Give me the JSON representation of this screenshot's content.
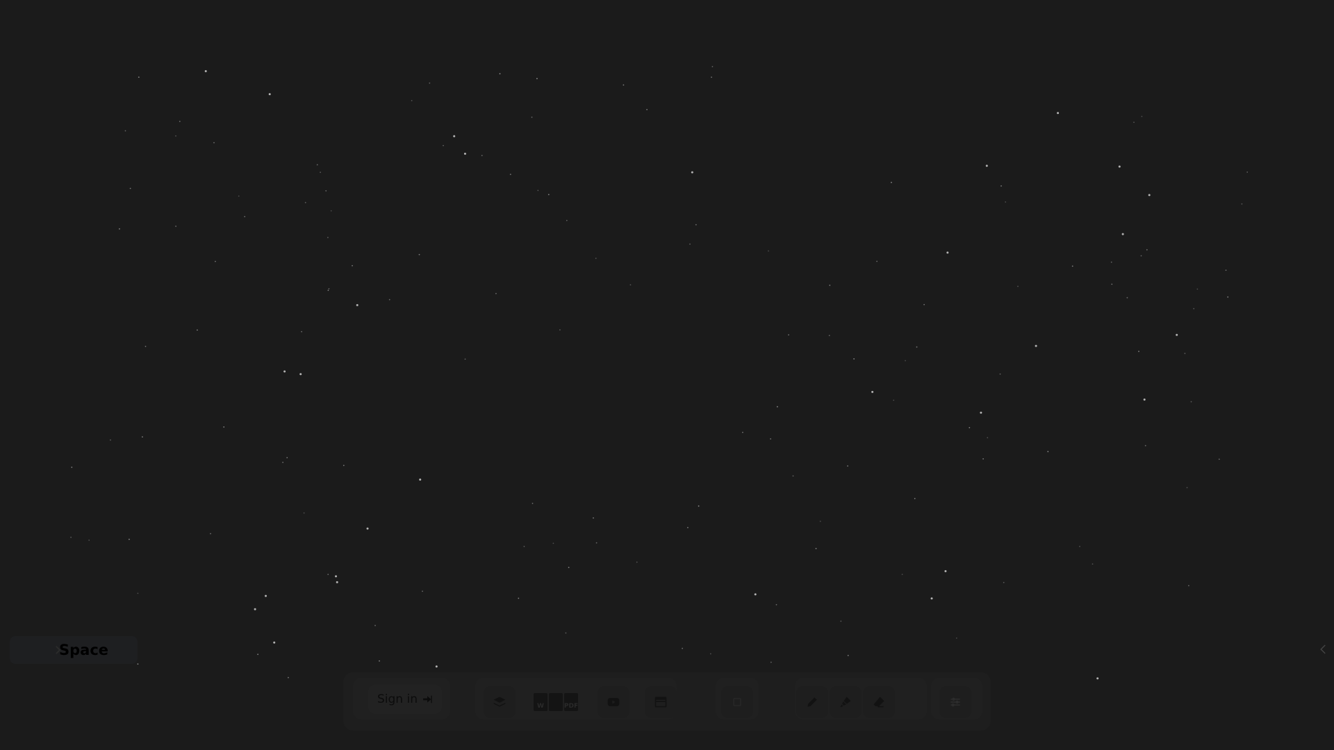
{
  "canvas": {
    "background": "#1b1b1b",
    "star_color": "#d9d9d9"
  },
  "space_panel": {
    "label": "Space",
    "chevron_icon": "chevron-right-icon"
  },
  "right_edge": {
    "icon": "chevron-left-icon"
  },
  "toolbar": {
    "sign_in_label": "Sign in",
    "sign_in_icon": "sign-in-icon",
    "tools": [
      {
        "name": "layers-icon"
      },
      {
        "name": "documents-icon",
        "docs": [
          "W",
          "",
          "PDF"
        ]
      },
      {
        "name": "youtube-icon"
      },
      {
        "name": "browser-window-icon"
      },
      {
        "name": "square-icon"
      },
      {
        "name": "pencil-icon"
      },
      {
        "name": "marker-icon"
      },
      {
        "name": "eraser-icon"
      },
      {
        "name": "settings-sliders-icon"
      }
    ]
  }
}
